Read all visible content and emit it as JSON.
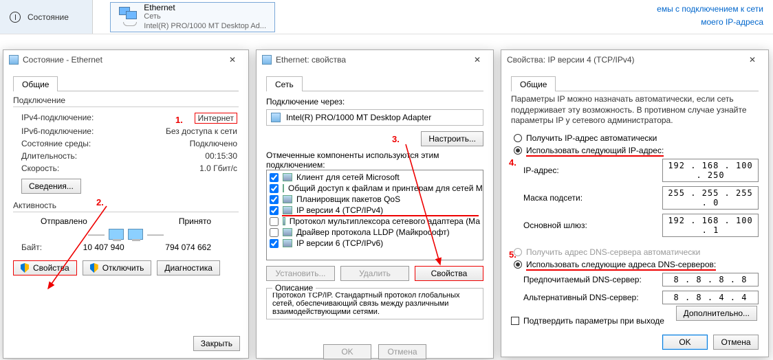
{
  "topbar": {
    "state_label": "Состояние",
    "eth_title": "Ethernet",
    "eth_sub1": "Сеть",
    "eth_sub2": "Intel(R) PRO/1000 MT Desktop Ad...",
    "link1": "емы с подключением к сети",
    "link2": "моего IP-адреса"
  },
  "dlg1": {
    "title": "Состояние - Ethernet",
    "tab": "Общие",
    "grp_conn": "Подключение",
    "ipv4_label": "IPv4-подключение:",
    "ipv4_value": "Интернет",
    "ipv6_label": "IPv6-подключение:",
    "ipv6_value": "Без доступа к сети",
    "media_label": "Состояние среды:",
    "media_value": "Подключено",
    "dur_label": "Длительность:",
    "dur_value": "00:15:30",
    "speed_label": "Скорость:",
    "speed_value": "1.0 Гбит/с",
    "details_btn": "Сведения...",
    "grp_act": "Активность",
    "sent": "Отправлено",
    "recv": "Принято",
    "bytes_label": "Байт:",
    "bytes_sent": "10 407 940",
    "bytes_recv": "794 074 662",
    "props_btn": "Свойства",
    "disable_btn": "Отключить",
    "diag_btn": "Диагностика",
    "close_btn": "Закрыть"
  },
  "dlg2": {
    "title": "Ethernet: свойства",
    "tab": "Сеть",
    "conn_through_label": "Подключение через:",
    "adapter": "Intel(R) PRO/1000 MT Desktop Adapter",
    "configure_btn": "Настроить...",
    "components_label": "Отмеченные компоненты используются этим подключением:",
    "items": [
      {
        "checked": true,
        "label": "Клиент для сетей Microsoft"
      },
      {
        "checked": true,
        "label": "Общий доступ к файлам и принтерам для сетей Mi"
      },
      {
        "checked": true,
        "label": "Планировщик пакетов QoS"
      },
      {
        "checked": true,
        "label": "IP версии 4 (TCP/IPv4)",
        "highlight": true
      },
      {
        "checked": false,
        "label": "Протокол мультиплексора сетевого адаптера (Ма"
      },
      {
        "checked": false,
        "label": "Драйвер протокола LLDP (Майкрософт)"
      },
      {
        "checked": true,
        "label": "IP версии 6 (TCP/IPv6)"
      }
    ],
    "install_btn": "Установить...",
    "remove_btn": "Удалить",
    "props_btn": "Свойства",
    "desc_cap": "Описание",
    "desc_text": "Протокол TCP/IP. Стандартный протокол глобальных сетей, обеспечивающий связь между различными взаимодействующими сетями.",
    "ok_btn": "OK",
    "cancel_btn": "Отмена"
  },
  "dlg3": {
    "title": "Свойства: IP версии 4 (TCP/IPv4)",
    "tab": "Общие",
    "para": "Параметры IP можно назначать автоматически, если сеть поддерживает эту возможность. В противном случае узнайте параметры IP у сетевого администратора.",
    "r_auto_ip": "Получить IP-адрес автоматически",
    "r_static_ip": "Использовать следующий IP-адрес:",
    "ip_label": "IP-адрес:",
    "ip_value": "192 . 168 . 100 . 250",
    "mask_label": "Маска подсети:",
    "mask_value": "255 . 255 . 255 .  0",
    "gw_label": "Основной шлюз:",
    "gw_value": "192 . 168 . 100 .  1",
    "r_auto_dns": "Получить адрес DNS-сервера автоматически",
    "r_static_dns": "Использовать следующие адреса DNS-серверов:",
    "dns1_label": "Предпочитаемый DNS-сервер:",
    "dns1_value": "8  .  8  .  8  .  8",
    "dns2_label": "Альтернативный DNS-сервер:",
    "dns2_value": "8  .  8  .  4  .  4",
    "confirm_exit": "Подтвердить параметры при выходе",
    "advanced_btn": "Дополнительно...",
    "ok_btn": "OK",
    "cancel_btn": "Отмена"
  },
  "anno": {
    "n1": "1.",
    "n2": "2.",
    "n3": "3.",
    "n4": "4.",
    "n5": "5."
  }
}
